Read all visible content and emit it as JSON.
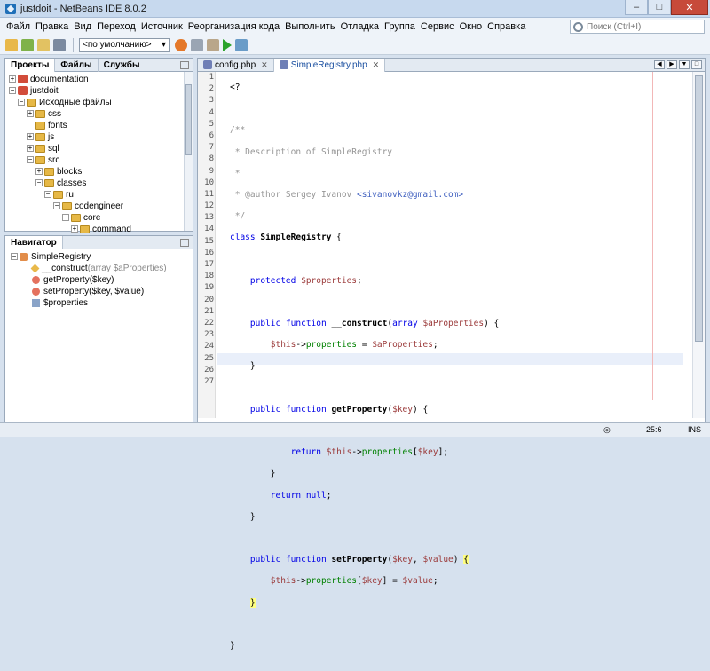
{
  "window": {
    "title": "justdoit - NetBeans IDE 8.0.2",
    "min": "–",
    "max": "□",
    "close": "✕"
  },
  "menu": [
    "Файл",
    "Правка",
    "Вид",
    "Переход",
    "Источник",
    "Реорганизация кода",
    "Выполнить",
    "Отладка",
    "Группа",
    "Сервис",
    "Окно",
    "Справка"
  ],
  "search": {
    "placeholder": "Поиск (Ctrl+I)"
  },
  "toolbar": {
    "config": "<по умолчанию>"
  },
  "projects_panel": {
    "tabs": [
      "Проекты",
      "Файлы",
      "Службы"
    ],
    "tree": [
      {
        "label": "documentation",
        "indent": 0,
        "exp": "+",
        "icon": "project"
      },
      {
        "label": "justdoit",
        "indent": 0,
        "exp": "−",
        "icon": "project"
      },
      {
        "label": "Исходные файлы",
        "indent": 1,
        "exp": "−",
        "icon": "folder"
      },
      {
        "label": "css",
        "indent": 2,
        "exp": "+",
        "icon": "folder"
      },
      {
        "label": "fonts",
        "indent": 2,
        "exp": "",
        "icon": "folder"
      },
      {
        "label": "js",
        "indent": 2,
        "exp": "+",
        "icon": "folder"
      },
      {
        "label": "sql",
        "indent": 2,
        "exp": "+",
        "icon": "folder"
      },
      {
        "label": "src",
        "indent": 2,
        "exp": "−",
        "icon": "folder"
      },
      {
        "label": "blocks",
        "indent": 3,
        "exp": "+",
        "icon": "folder"
      },
      {
        "label": "classes",
        "indent": 3,
        "exp": "−",
        "icon": "folder"
      },
      {
        "label": "ru",
        "indent": 4,
        "exp": "−",
        "icon": "folder"
      },
      {
        "label": "codengineer",
        "indent": 5,
        "exp": "−",
        "icon": "folder"
      },
      {
        "label": "core",
        "indent": 6,
        "exp": "−",
        "icon": "folder"
      },
      {
        "label": "command",
        "indent": 7,
        "exp": "+",
        "icon": "folder"
      }
    ]
  },
  "navigator": {
    "tab": "Навигатор",
    "items": [
      {
        "label": "SimpleRegistry",
        "kind": "class",
        "indent": 0
      },
      {
        "label": "__construct",
        "param": "(array $aProperties)",
        "kind": "constructor",
        "indent": 1
      },
      {
        "label": "getProperty($key)",
        "param": "",
        "kind": "method",
        "indent": 1
      },
      {
        "label": "setProperty($key, $value)",
        "param": "",
        "kind": "method",
        "indent": 1
      },
      {
        "label": "$properties",
        "param": "",
        "kind": "field",
        "indent": 1
      }
    ]
  },
  "editor": {
    "tabs": [
      {
        "label": "config.php"
      },
      {
        "label": "SimpleRegistry.php"
      }
    ],
    "line_numbers": [
      "1",
      "2",
      "3",
      "4",
      "5",
      "6",
      "7",
      "8",
      "9",
      "10",
      "11",
      "12",
      "13",
      "14",
      "15",
      "16",
      "17",
      "18",
      "19",
      "20",
      "21",
      "22",
      "23",
      "24",
      "25",
      "26",
      "27"
    ],
    "current_line": 25
  },
  "status": {
    "position": "25:6",
    "mode": "INS"
  },
  "colors": {
    "keyword": "#0000e6",
    "comment": "#969696",
    "property": "#008000",
    "variable": "#9b3a3a"
  }
}
